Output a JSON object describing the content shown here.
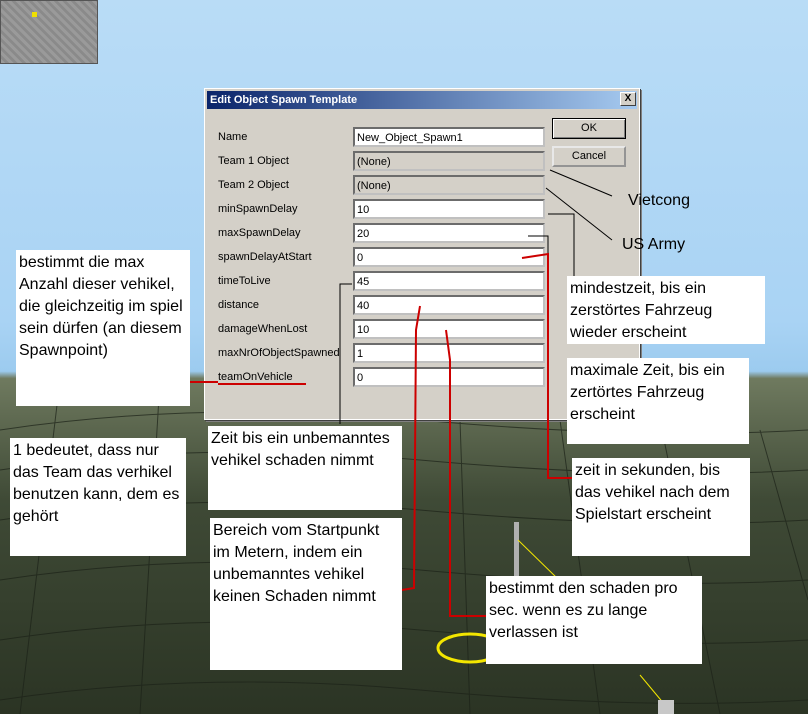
{
  "dialog": {
    "title": "Edit Object Spawn Template",
    "close_label": "X",
    "ok_label": "OK",
    "cancel_label": "Cancel",
    "rows": [
      {
        "label": "Name",
        "value": "New_Object_Spawn1",
        "disabled": false
      },
      {
        "label": "Team 1 Object",
        "value": "(None)",
        "disabled": true
      },
      {
        "label": "Team 2 Object",
        "value": "(None)",
        "disabled": true
      },
      {
        "label": "minSpawnDelay",
        "value": "10",
        "disabled": false
      },
      {
        "label": "maxSpawnDelay",
        "value": "20",
        "disabled": false
      },
      {
        "label": "spawnDelayAtStart",
        "value": "0",
        "disabled": false
      },
      {
        "label": "timeToLive",
        "value": "45",
        "disabled": false
      },
      {
        "label": "distance",
        "value": "40",
        "disabled": false
      },
      {
        "label": "damageWhenLost",
        "value": "10",
        "disabled": false
      },
      {
        "label": "maxNrOfObjectSpawned",
        "value": "1",
        "disabled": false
      },
      {
        "label": "teamOnVehicle",
        "value": "0",
        "disabled": false
      }
    ]
  },
  "annotations": {
    "vietcong": "Vietcong",
    "us_army": "US Army",
    "max_count": "bestimmt die max Anzahl dieser vehikel, die gleichzeitig im spiel sein dürfen (an diesem Spawnpoint)",
    "team_on_vehicle": "1 bedeutet, dass nur das Team das verhikel benutzen kann, dem es gehört",
    "time_to_live": "Zeit bis ein unbemanntes vehikel schaden nimmt",
    "distance": "Bereich vom Startpunkt im Metern, indem ein unbemanntes vehikel keinen Schaden nimmt",
    "min_spawn": "mindestzeit, bis ein zerstörtes Fahrzeug wieder erscheint",
    "max_spawn": "maximale Zeit, bis ein zertörtes Fahrzeug erscheint",
    "spawn_at_start": "zeit in sekunden, bis das vehikel nach dem Spielstart erscheint",
    "damage_when_lost": "bestimmt den schaden pro sec. wenn es zu lange verlassen ist"
  },
  "colors": {
    "annotation_line": "#cc0000",
    "dialog_face": "#d4d0c8",
    "titlebar": "#0a246a"
  }
}
